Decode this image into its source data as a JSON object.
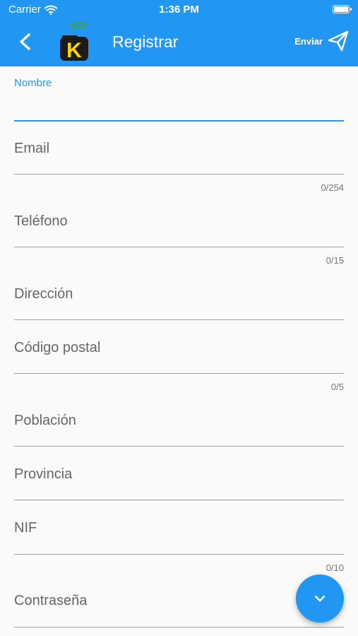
{
  "status": {
    "carrier": "Carrier",
    "time": "1:36 PM"
  },
  "appbar": {
    "title": "Registrar",
    "send_label": "Enviar",
    "logo_letter": "K"
  },
  "form": {
    "nombre": {
      "label": "Nombre",
      "value": ""
    },
    "email": {
      "label": "Email",
      "counter": "0/254"
    },
    "telefono": {
      "label": "Teléfono",
      "counter": "0/15"
    },
    "direccion": {
      "label": "Dirección"
    },
    "codigo_postal": {
      "label": "Código postal",
      "counter": "0/5"
    },
    "poblacion": {
      "label": "Población"
    },
    "provincia": {
      "label": "Provincia"
    },
    "nif": {
      "label": "NIF",
      "counter": "0/10"
    },
    "contrasena": {
      "label": "Contraseña"
    }
  },
  "colors": {
    "primary": "#2196f3",
    "background": "#fafafa"
  }
}
